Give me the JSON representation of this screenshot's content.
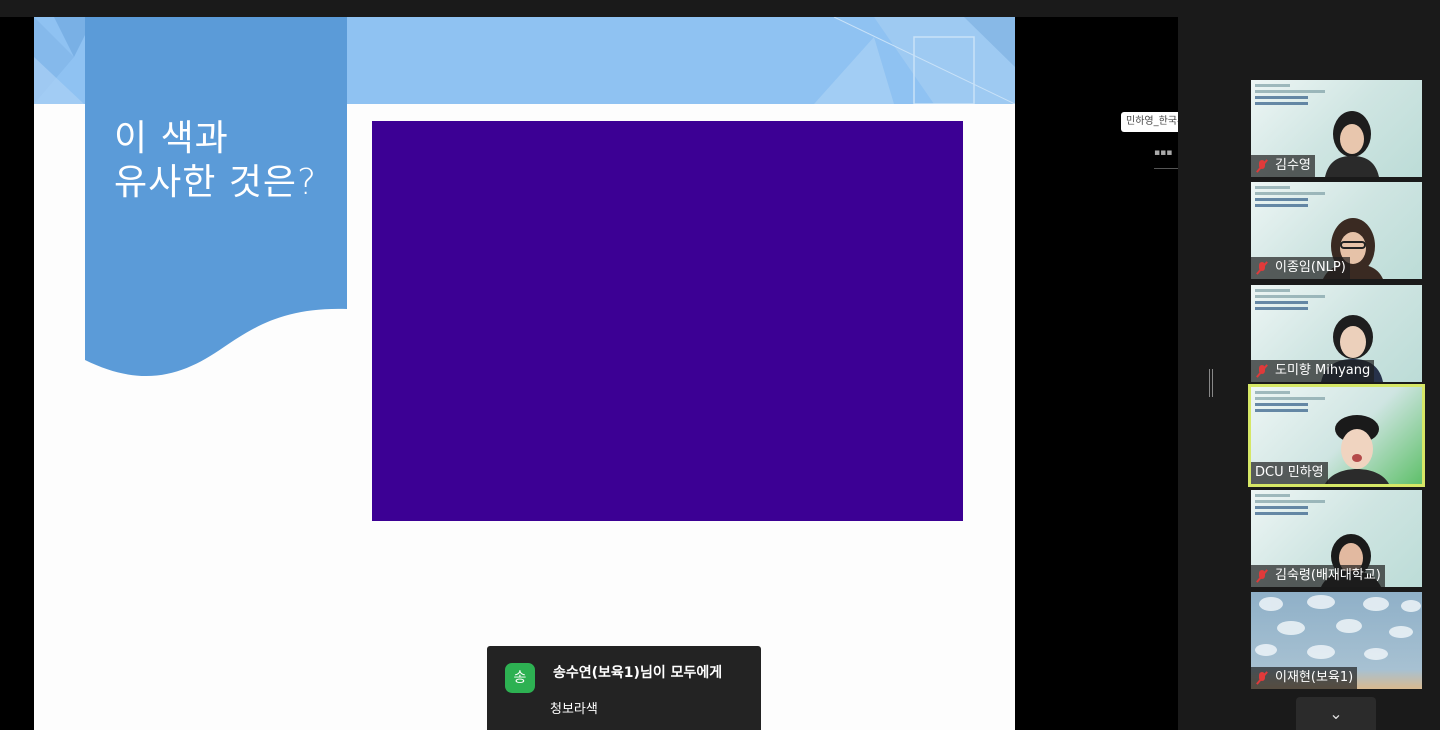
{
  "slide": {
    "title_line1": "이 색과",
    "title_line2": "유사한 것은?",
    "color_sample": "#3c0094"
  },
  "chat_toast": {
    "avatar_initial": "송",
    "sender": "송수연(보육1)님이 모두에게",
    "message": "청보라색"
  },
  "side_strip": {
    "tab_label": "민하영_한국부",
    "icon_label": "▪▪▪"
  },
  "participants": [
    {
      "name": "김수영",
      "muted": true
    },
    {
      "name": "이종임(NLP)",
      "muted": true
    },
    {
      "name": "도미향 Mihyang",
      "muted": true
    },
    {
      "name": "DCU 민하영",
      "muted": false,
      "active": true
    },
    {
      "name": "김숙령(배재대학교)",
      "muted": true
    },
    {
      "name": "이재현(보육1)",
      "muted": true
    }
  ],
  "scroll_down_icon": "chevron-down",
  "scroll_down_glyph": "⌄"
}
